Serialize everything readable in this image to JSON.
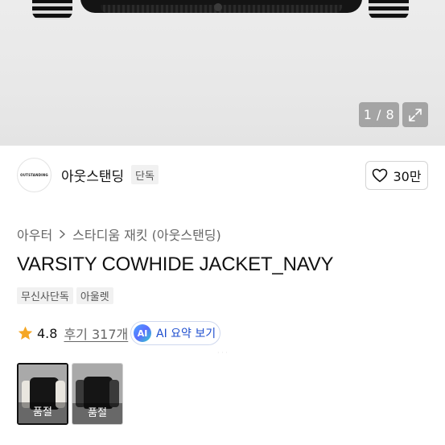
{
  "gallery": {
    "pager_current": "1",
    "pager_total": "8",
    "pager_text": "1 / 8",
    "expand_icon": "expand-icon"
  },
  "brand": {
    "logo_text": "OUTSTANDING",
    "name": "아웃스탠딩",
    "tag": "단독",
    "likes": "30만",
    "like_icon": "heart-icon"
  },
  "breadcrumb": {
    "category": "아우터",
    "subcategory": "스타디움 재킷 (아웃스탠딩)"
  },
  "product": {
    "title": "VARSITY COWHIDE JACKET_NAVY",
    "badges": [
      "무신사단독",
      "아울렛"
    ],
    "rating": "4.8",
    "reviews_label": "후기 317개",
    "ai_badge": "AI",
    "ai_button_label": "AI 요약 보기"
  },
  "options": [
    {
      "status": "품절",
      "sleeve_color": "#e9e6df"
    },
    {
      "status": "품절",
      "sleeve_color": "#3a3a3a"
    }
  ],
  "colors": {
    "star": "#f5a623",
    "ai_blue": "#1f4fcf"
  }
}
